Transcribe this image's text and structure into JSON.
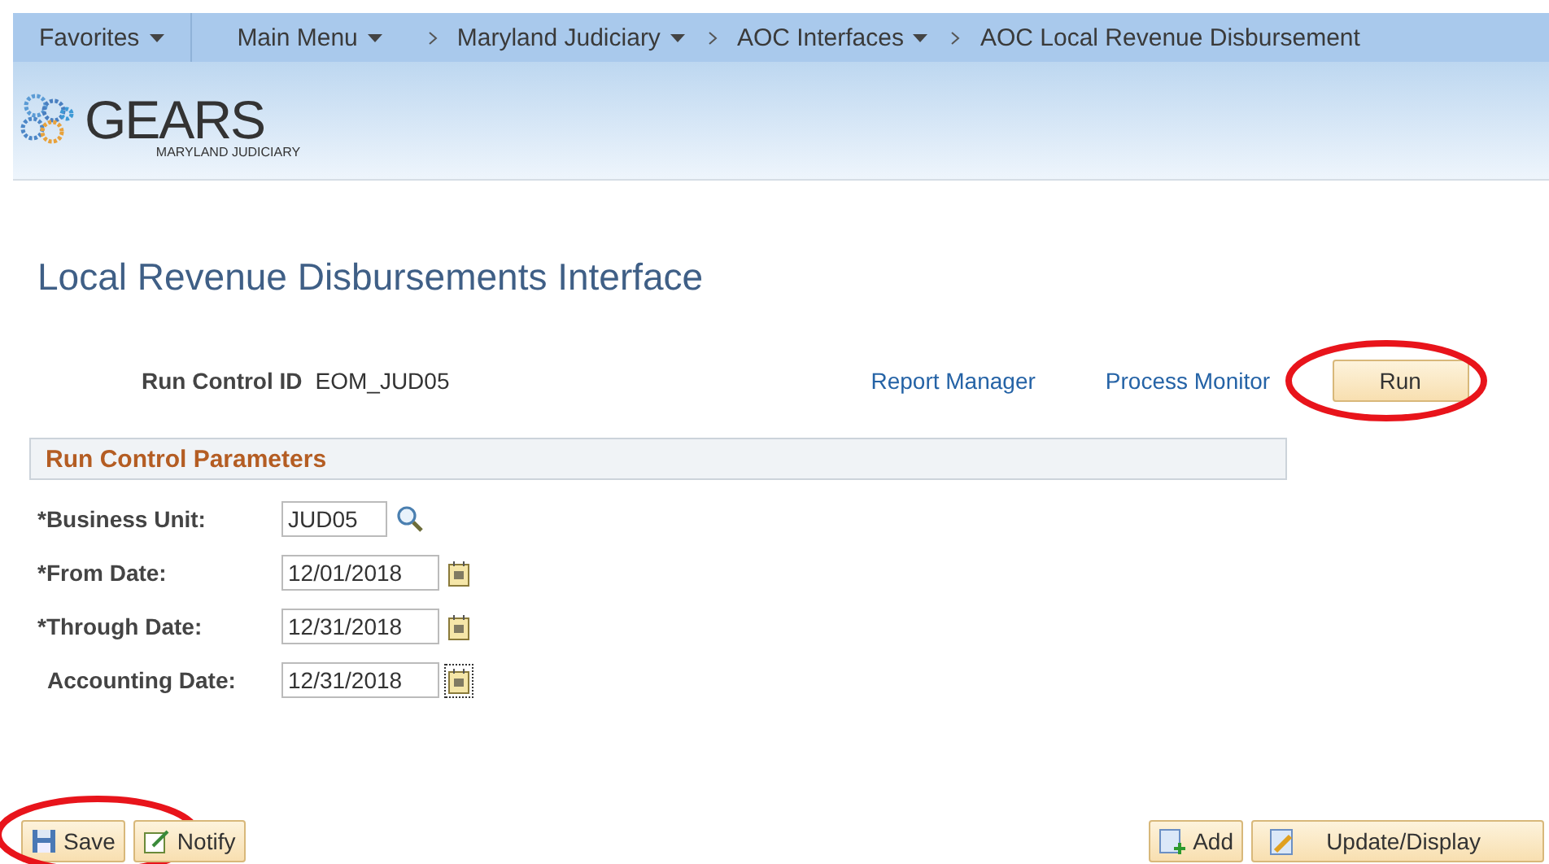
{
  "nav": [
    {
      "label": "Favorites",
      "kind": "menu"
    },
    {
      "label": "Main Menu",
      "kind": "menu"
    },
    {
      "label": "Maryland Judiciary",
      "kind": "crumb-menu"
    },
    {
      "label": "AOC Interfaces",
      "kind": "crumb-menu"
    },
    {
      "label": "AOC Local Revenue Disbursement",
      "kind": "crumb"
    }
  ],
  "logo": {
    "name": "GEARS",
    "subtitle": "MARYLAND JUDICIARY"
  },
  "page_title": "Local Revenue Disbursements Interface",
  "run_control": {
    "label": "Run Control ID",
    "value": "EOM_JUD05"
  },
  "links": [
    "Report Manager",
    "Process Monitor"
  ],
  "run_button": {
    "label": "Run",
    "highlighted": true
  },
  "section": {
    "title": "Run Control Parameters"
  },
  "fields": [
    {
      "label": "*Business Unit:",
      "value": "JUD05",
      "kind": "lookup",
      "focused": false
    },
    {
      "label": "*From Date:",
      "value": "12/01/2018",
      "kind": "date",
      "focused": false
    },
    {
      "label": "*Through Date:",
      "value": "12/31/2018",
      "kind": "date",
      "focused": false
    },
    {
      "label": "Accounting Date:",
      "value": "12/31/2018",
      "kind": "date",
      "focused": true
    }
  ],
  "toolbar_left": [
    {
      "label": "Save",
      "kind": "save",
      "highlighted": true
    },
    {
      "label": "Notify",
      "kind": "notify",
      "highlighted": false
    }
  ],
  "toolbar_right": [
    {
      "label": "Add",
      "kind": "add",
      "highlighted": false
    },
    {
      "label": "Update/Display",
      "kind": "update",
      "highlighted": false
    }
  ]
}
